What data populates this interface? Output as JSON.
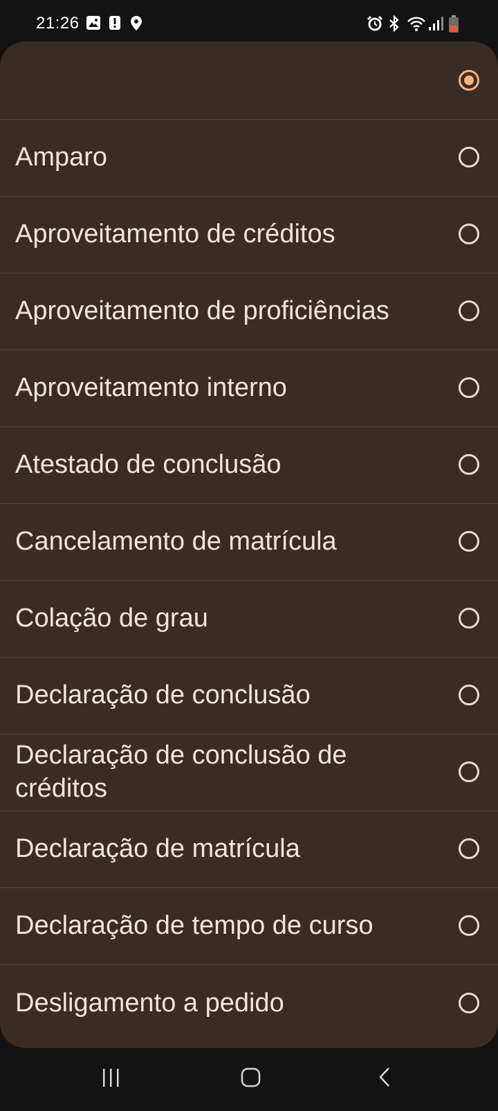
{
  "status_bar": {
    "time": "21:26",
    "left_icons": [
      "image-icon",
      "alert-icon",
      "location-icon"
    ],
    "right_icons": [
      "alarm-icon",
      "bluetooth-icon",
      "wifi-icon",
      "signal-icon",
      "battery-icon"
    ],
    "battery_color": "#e8553a"
  },
  "options": [
    {
      "label": "",
      "checked": true
    },
    {
      "label": "Amparo",
      "checked": false
    },
    {
      "label": "Aproveitamento de créditos",
      "checked": false
    },
    {
      "label": "Aproveitamento de proficiências",
      "checked": false
    },
    {
      "label": "Aproveitamento interno",
      "checked": false
    },
    {
      "label": "Atestado de conclusão",
      "checked": false
    },
    {
      "label": "Cancelamento de matrícula",
      "checked": false
    },
    {
      "label": "Colação de grau",
      "checked": false
    },
    {
      "label": "Declaração de conclusão",
      "checked": false
    },
    {
      "label": "Declaração de conclusão de créditos",
      "checked": false
    },
    {
      "label": "Declaração de matrícula",
      "checked": false
    },
    {
      "label": "Declaração de tempo de curso",
      "checked": false
    },
    {
      "label": "Desligamento a pedido",
      "checked": false
    }
  ],
  "nav_bar": {
    "buttons": [
      "recents-icon",
      "home-icon",
      "back-icon"
    ]
  },
  "colors": {
    "sheet_background": "#382c24",
    "accent": "#ffb27c",
    "text": "#efe5df",
    "divider": "#524338"
  }
}
